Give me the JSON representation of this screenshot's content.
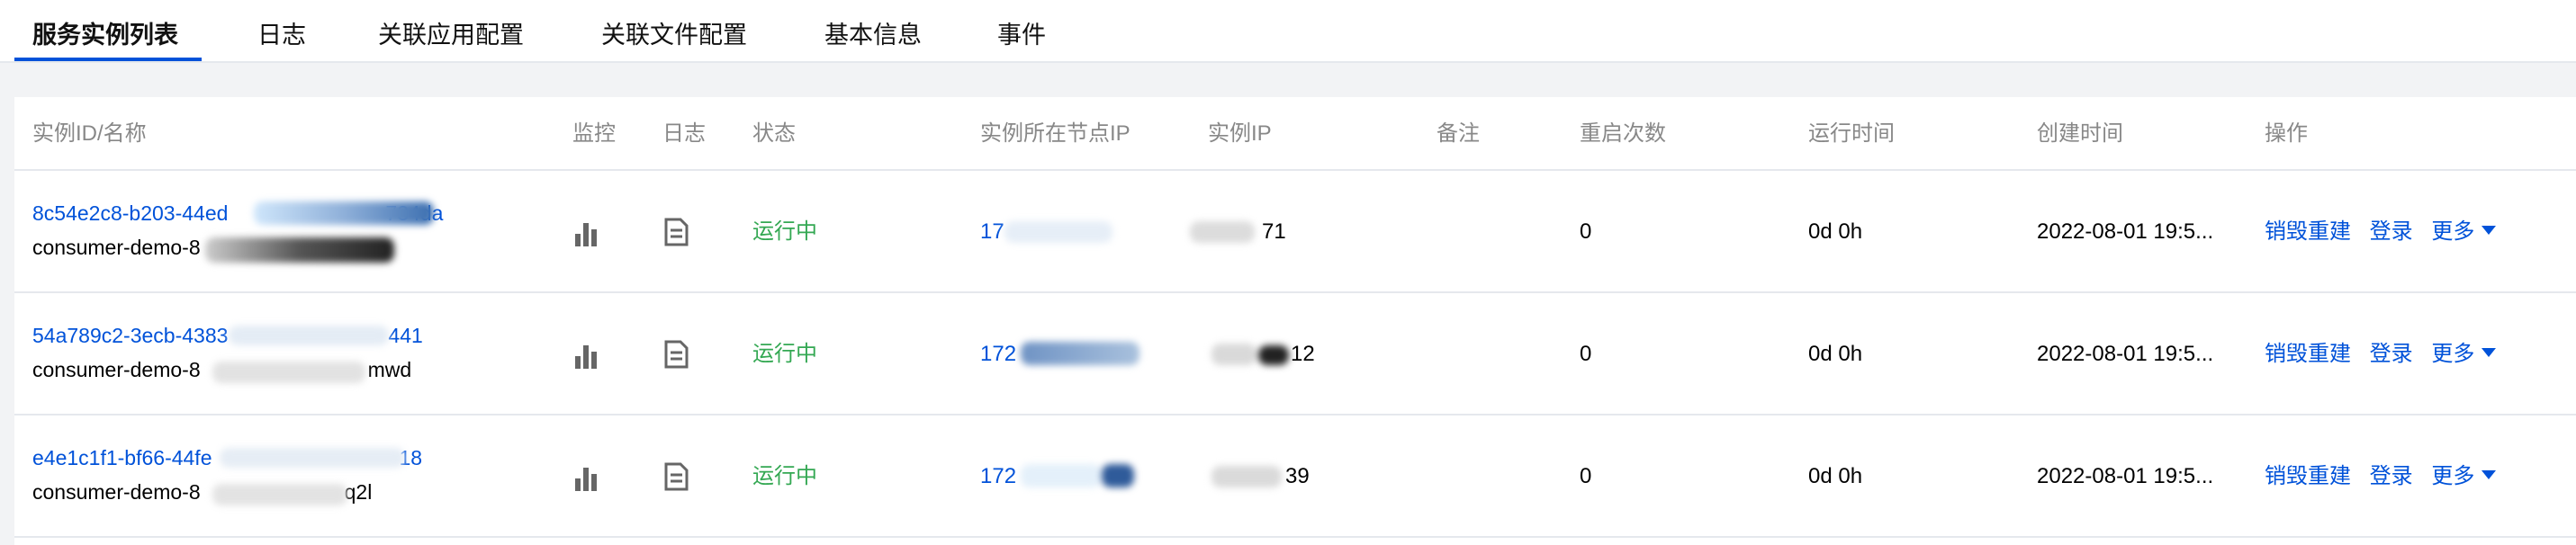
{
  "tabs": [
    "服务实例列表",
    "日志",
    "关联应用配置",
    "关联文件配置",
    "基本信息",
    "事件"
  ],
  "columns": [
    "实例ID/名称",
    "监控",
    "日志",
    "状态",
    "实例所在节点IP",
    "实例IP",
    "备注",
    "重启次数",
    "运行时间",
    "创建时间",
    "操作"
  ],
  "rows": [
    {
      "id": "8c54e2c8-b203-44ed",
      "id_tail": "734da",
      "name": "consumer-demo-8",
      "name_tail": "",
      "status": "运行中",
      "node_ip": "17",
      "ip": "71",
      "restarts": "0",
      "uptime": "0d 0h",
      "created": "2022-08-01 19:5...",
      "ops": {
        "rebuild": "销毁重建",
        "login": "登录",
        "more": "更多"
      }
    },
    {
      "id": "54a789c2-3ecb-4383",
      "id_tail": "441",
      "name": "consumer-demo-8",
      "name_tail": "mwd",
      "status": "运行中",
      "node_ip": "172",
      "ip": "12",
      "restarts": "0",
      "uptime": "0d 0h",
      "created": "2022-08-01 19:5...",
      "ops": {
        "rebuild": "销毁重建",
        "login": "登录",
        "more": "更多"
      }
    },
    {
      "id": "e4e1c1f1-bf66-44fe",
      "id_tail": "18",
      "name": "consumer-demo-8",
      "name_tail": "q2l",
      "status": "运行中",
      "node_ip": "172",
      "ip": "39",
      "restarts": "0",
      "uptime": "0d 0h",
      "created": "2022-08-01 19:5...",
      "ops": {
        "rebuild": "销毁重建",
        "login": "登录",
        "more": "更多"
      }
    }
  ],
  "icons": {
    "monitor": "bar-chart-icon",
    "log": "document-icon",
    "more": "caret-down-icon"
  },
  "colors": {
    "link": "#0052d9",
    "status_running": "#34a853",
    "header_text": "#888888",
    "tab_underline": "#0052d9"
  }
}
